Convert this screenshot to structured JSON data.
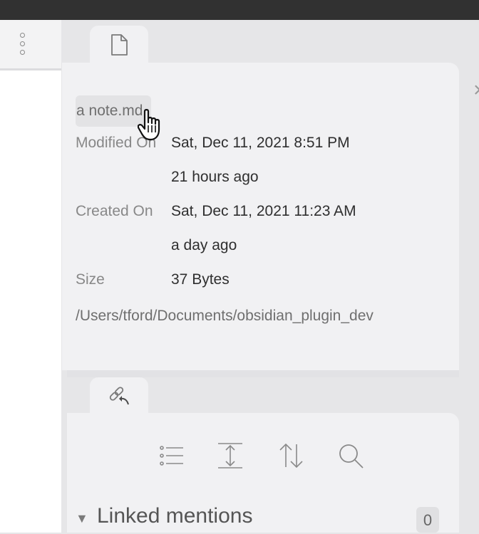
{
  "file_properties": {
    "filename": "a note.md",
    "rows": [
      {
        "label": "Modified On",
        "value": "Sat, Dec 11, 2021 8:51 PM"
      },
      {
        "label": "",
        "value": "21 hours ago"
      },
      {
        "label": "Created On",
        "value": "Sat, Dec 11, 2021 11:23 AM"
      },
      {
        "label": "",
        "value": "a day ago"
      },
      {
        "label": "Size",
        "value": "37 Bytes"
      }
    ],
    "path": "/Users/tford/Documents/obsidian_plugin_dev",
    "close_symbol": "×"
  },
  "tabs": {
    "file_tab_icon": "file-icon",
    "backlinks_tab_icon": "backlink-icon"
  },
  "left_pane": {
    "menu_icon": "more-options-icon"
  },
  "backlinks": {
    "toolbar_icons": [
      "list-icon",
      "expand-icon",
      "sort-icon",
      "search-icon"
    ],
    "linked_mentions_label": "Linked mentions",
    "linked_mentions_count": "0",
    "caret_symbol": "▼"
  },
  "colors": {
    "titlebar": "#313131",
    "pane_bg": "#f1f1f3",
    "label_gray": "#888888",
    "text_dark": "#2f2f2f"
  }
}
